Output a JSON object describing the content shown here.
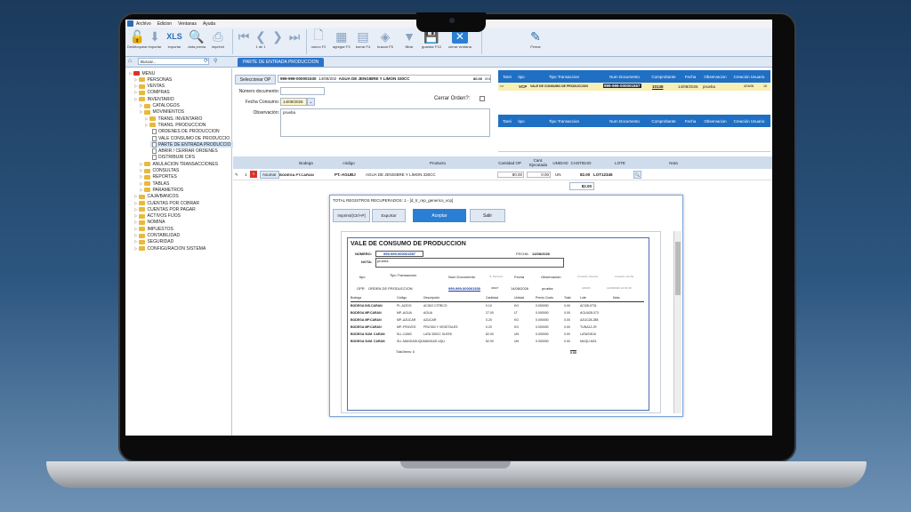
{
  "menubar": {
    "items": [
      "Archivo",
      "Edicion",
      "Ventanas",
      "Ayuda"
    ]
  },
  "toolbar": {
    "bloquear": "Desbloquear",
    "importar": "importar",
    "exportar": "exportar",
    "vista_previa": "vista previa",
    "imprimir": "imprimir",
    "nav_pos": "1 de 1",
    "nuevo": "nuevo F2",
    "agregar": "agregar F3",
    "borrar": "borrar F4",
    "buscar": "buscar F5",
    "filtrar": "filtrar",
    "guardar": "guardar F10",
    "cerrar": "cerrar ventana",
    "firmar": "Firmar"
  },
  "subbar": {
    "search_placeholder": "Buscar...",
    "tab": "PARTE DE ENTRADA PRODUCCION"
  },
  "tree": [
    {
      "label": "MENU",
      "indent": 0,
      "type": "root"
    },
    {
      "label": "PERSONAS",
      "indent": 1,
      "type": "folder"
    },
    {
      "label": "VENTAS",
      "indent": 1,
      "type": "folder"
    },
    {
      "label": "COMPRAS",
      "indent": 1,
      "type": "folder"
    },
    {
      "label": "INVENTARIO",
      "indent": 1,
      "type": "folder"
    },
    {
      "label": "CATALOGOS",
      "indent": 2,
      "type": "folder"
    },
    {
      "label": "MOVIMIENTOS",
      "indent": 2,
      "type": "folder"
    },
    {
      "label": "TRANS. INVENTARIO",
      "indent": 3,
      "type": "folder"
    },
    {
      "label": "TRANS. PRODUCCION",
      "indent": 3,
      "type": "folder"
    },
    {
      "label": "ORDENES DE PRODUCCION",
      "indent": 4,
      "type": "doc"
    },
    {
      "label": "VALE CONSUMO DE PRODUCCIO",
      "indent": 4,
      "type": "doc"
    },
    {
      "label": "PARTE DE ENTRADA PRODUCCIO",
      "indent": 4,
      "type": "doc",
      "selected": true
    },
    {
      "label": "ABRIR / CERRAR ORDENES",
      "indent": 4,
      "type": "doc"
    },
    {
      "label": "DISTRIBUIR CIFS",
      "indent": 4,
      "type": "doc"
    },
    {
      "label": "ANULACION TRANSACCIONES",
      "indent": 2,
      "type": "folder"
    },
    {
      "label": "CONSULTAS",
      "indent": 2,
      "type": "folder"
    },
    {
      "label": "REPORTES",
      "indent": 2,
      "type": "folder"
    },
    {
      "label": "TABLAS",
      "indent": 2,
      "type": "folder"
    },
    {
      "label": "PARAMETROS",
      "indent": 2,
      "type": "folder"
    },
    {
      "label": "CAJA/BANCOS",
      "indent": 1,
      "type": "folder"
    },
    {
      "label": "CUENTAS POR COBRAR",
      "indent": 1,
      "type": "folder"
    },
    {
      "label": "CUENTAS POR PAGAR",
      "indent": 1,
      "type": "folder"
    },
    {
      "label": "ACTIVOS FIJOS",
      "indent": 1,
      "type": "folder"
    },
    {
      "label": "NOMINA",
      "indent": 1,
      "type": "folder"
    },
    {
      "label": "IMPUESTOS",
      "indent": 1,
      "type": "folder"
    },
    {
      "label": "CONTABILIDAD",
      "indent": 1,
      "type": "folder"
    },
    {
      "label": "SEGURIDAD",
      "indent": 1,
      "type": "folder"
    },
    {
      "label": "CONFIGURACION SISTEMA",
      "indent": 1,
      "type": "folder"
    }
  ],
  "form": {
    "seleccionar_op": "Seleccionar OP",
    "op_number": "999-999-000001530",
    "op_date": "14/08/202",
    "op_product": "AGUA DE JENGIBRE Y LIMON 330CC",
    "op_qty": "80.00",
    "op_unit": "001",
    "numero_label": "Número documento:",
    "fecha_label": "Fecha Consumo:",
    "fecha_value": "14/08/2026",
    "obs_label": "Observación:",
    "obs_value": "prueba",
    "cerrar_orden": "Cerrar Orden?:"
  },
  "grid_top": {
    "headers": [
      "Tarei",
      "tipo",
      "Tipo Transaccion",
      "Num Documento",
      "Comprobante",
      "Fecha",
      "Observacion",
      "Creación Usuario"
    ],
    "row": {
      "tipo": "VCP",
      "transaccion": "VALE DE CONSUMO DE PRODUCCION",
      "num": "999-999-000001557",
      "comprobante": "10138",
      "fecha": "14/08/2026",
      "obs": "prueba",
      "usuario": "ADMIN",
      "extra": "16"
    }
  },
  "grid_top2": {
    "headers": [
      "Tarei",
      "tipo",
      "Tipo Transaccion",
      "Num Documento",
      "Comprobante",
      "Fecha",
      "Observacion",
      "Creación Usuario"
    ]
  },
  "grid_detail": {
    "headers": [
      "Bodega",
      "código",
      "Producto",
      "Cantidad OP",
      "Cant. Ejecutada",
      "UNIDAD",
      "CANTIDAD",
      "LOTE",
      "Nota"
    ],
    "row": {
      "index": "1",
      "btn": "Asumar",
      "bodega": "BODEGA PT.CARAN",
      "codigo": "PT.-AGUBJ",
      "producto": "AGUA DE JENGIBRE Y LIMON 330CC",
      "cant_op": "80.00",
      "cant_ej": "0.00",
      "unidad": "UN",
      "cantidad": "82.00",
      "lote": "LOT12345"
    },
    "total": "82.00"
  },
  "dialog": {
    "header": "TOTAL REGISTROS RECUPERADOS: 1  -  [d_tr_rep_generico_vcp]",
    "imprimir": "Imprimir[Ctrl+P]",
    "exportar": "Exportar",
    "aceptar": "Aceptar",
    "salir": "Salir",
    "report": {
      "title": "VALE DE CONSUMO DE PRODUCCION",
      "numero_label": "NÚMERO:",
      "numero": "999-999-000001557",
      "fecha_label": "FECHA:",
      "fecha": "14/08/2026",
      "nota_label": "NOTA:",
      "nota": "prueba",
      "h_tipo": "tipo",
      "h_trans": "Tipo Transaccion",
      "h_num": "Num Documento",
      "h_nper": "N. Persona",
      "h_fecha": "Fecha",
      "h_obs": "Observacion",
      "h_cu": "Creación Usuario",
      "h_cf": "Creación Fecha",
      "op_row": {
        "tipo": "OPR",
        "trans": "ORDEN DE PRODUCCION",
        "num": "999-999-000001530",
        "nper": "33627",
        "fecha": "14/08/2026",
        "obs": "prueba",
        "usuario": "ADMIN",
        "cfecha": "14/08/2026 22:09:30"
      },
      "det_headers": [
        "Bodega",
        "Código",
        "Descripción",
        "Cantidad",
        "Unidad",
        "Precio Costo",
        "Total",
        "Lote",
        "Nota"
      ],
      "items": [
        {
          "bodega": "BODEGA INS.CARAN",
          "codigo": "PI.-ACIDO",
          "desc": "ACIDO CITRICO",
          "cant": "0.10",
          "unidad": "KG",
          "precio": "0.000000",
          "total": "0.00",
          "lote": "ACI28-0731"
        },
        {
          "bodega": "BODEGA MP.CARAN",
          "codigo": "MP.-AGUA",
          "desc": "AGUA",
          "cant": "27.00",
          "unidad": "LT",
          "precio": "0.000000",
          "total": "0.00",
          "lote": "AGUA28-073"
        },
        {
          "bodega": "BODEGA MP.CARAN",
          "codigo": "MP.-AZUCAR",
          "desc": "AZUCAR",
          "cant": "0.20",
          "unidad": "KG",
          "precio": "0.000000",
          "total": "0.00",
          "lote": "AZUC28-288"
        },
        {
          "bodega": "BODEGA MP.CARAN",
          "codigo": "MP.-FRUVEG",
          "desc": "FRUTAS Y VEGETALES",
          "cant": "0.20",
          "unidad": "KG",
          "precio": "0.000000",
          "total": "0.00",
          "lote": "TUNA12-29"
        },
        {
          "bodega": "BODEGA SUM. CARAN",
          "codigo": "SU.-CANS",
          "desc": "LATA 330CC SLEEK",
          "cant": "82.00",
          "unidad": "UN",
          "precio": "0.000000",
          "total": "0.00",
          "lote": "LATA/NS10"
        },
        {
          "bodega": "BODEGA SUM. CARAN",
          "codigo": "SU.-MANGASUQU",
          "desc": "MANGAS UQU",
          "cant": "82.00",
          "unidad": "UN",
          "precio": "0.000000",
          "total": "0.00",
          "lote": "MUQU-M21"
        }
      ],
      "total_items": "Total Items: 6",
      "total_sum": "0.00"
    }
  }
}
